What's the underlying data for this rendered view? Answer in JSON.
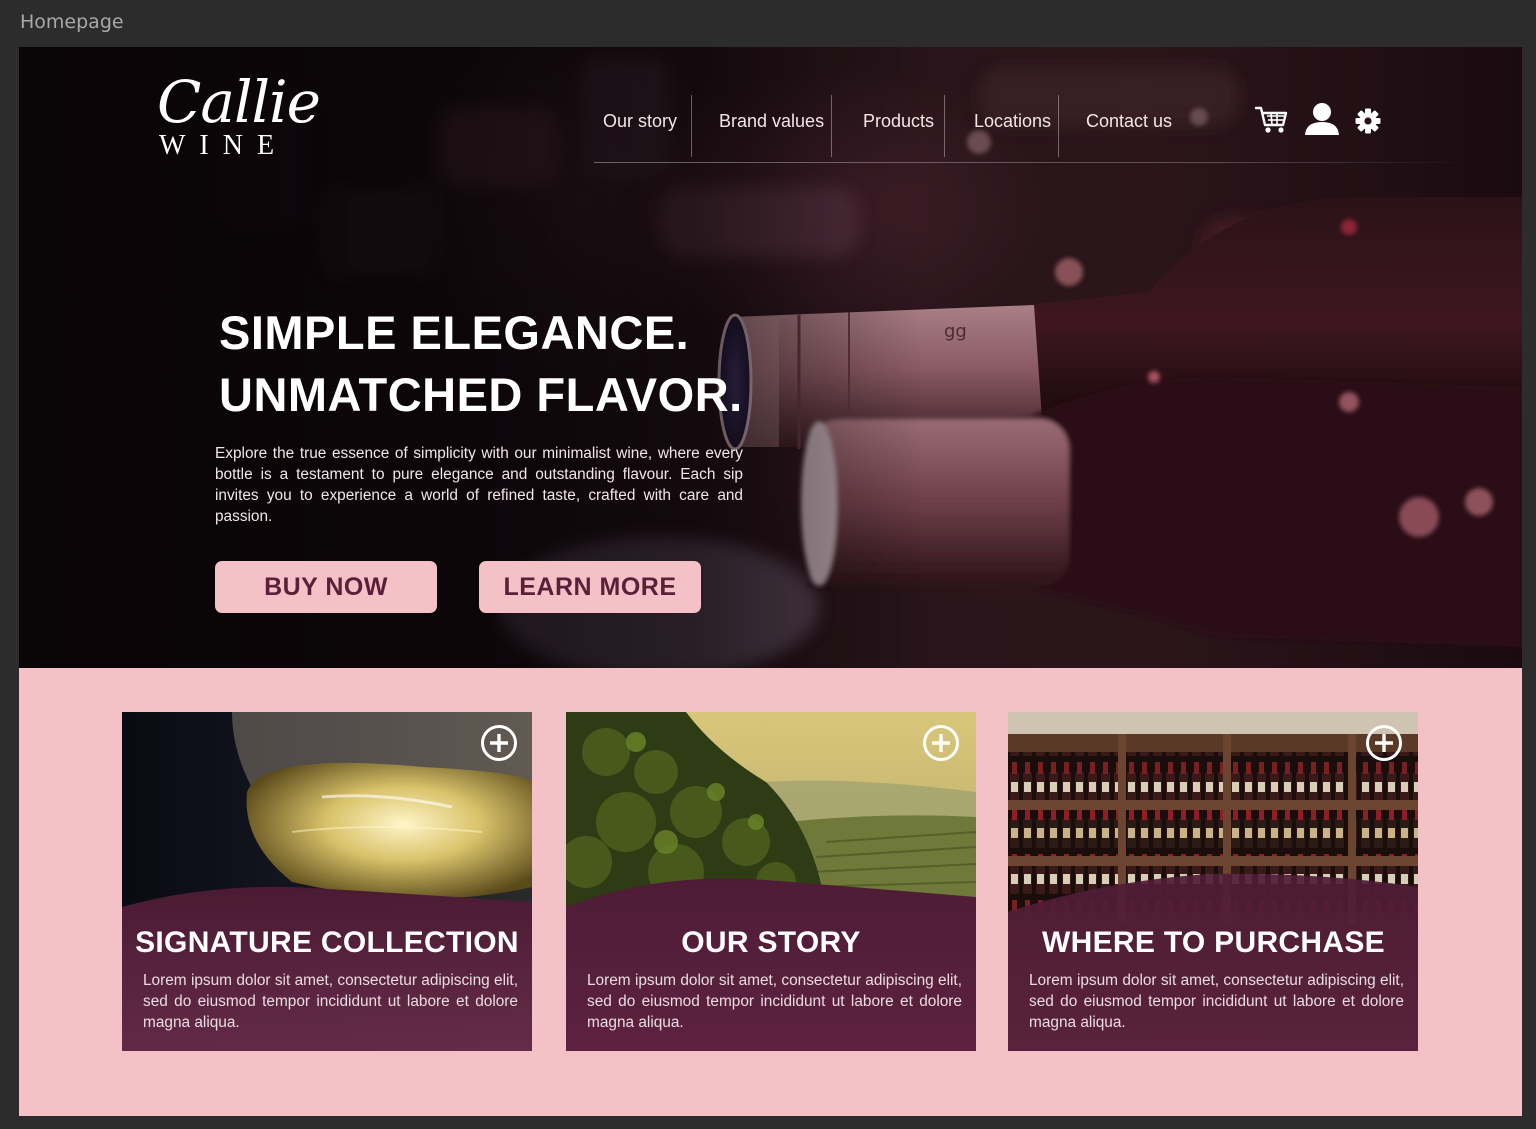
{
  "frame": {
    "label": "Homepage"
  },
  "brand": {
    "script": "Callie",
    "word": "WINE"
  },
  "nav": {
    "items": [
      "Our story",
      "Brand values",
      "Products",
      "Locations",
      "Contact us"
    ],
    "icons": [
      "cart-icon",
      "user-icon",
      "gear-icon"
    ]
  },
  "hero": {
    "title_line1": "SIMPLE ELEGANCE.",
    "title_line2": "UNMATCHED FLAVOR.",
    "body": "Explore the true essence of simplicity with our minimalist wine, where every bottle is a testament to pure elegance and outstanding flavour. Each sip invites you to experience a world of refined taste, crafted with care and passion.",
    "buy_label": "BUY NOW",
    "learn_label": "LEARN MORE"
  },
  "cards": [
    {
      "title": "SIGNATURE COLLECTION",
      "text": "Lorem ipsum dolor sit amet, consectetur adipiscing elit, sed do eiusmod tempor incididunt ut labore et dolore magna aliqua."
    },
    {
      "title": "OUR STORY",
      "text": "Lorem ipsum dolor sit amet, consectetur adipiscing elit, sed do eiusmod tempor incididunt ut labore et dolore magna aliqua."
    },
    {
      "title": "WHERE TO PURCHASE",
      "text": "Lorem ipsum dolor sit amet, consectetur adipiscing elit, sed do eiusmod tempor incididunt ut labore et dolore magna aliqua."
    }
  ],
  "colors": {
    "accent_pink": "#f4c1c6",
    "plum": "#5b1f3a",
    "card_overlay": "#4e1c36",
    "frame_bg": "#2c2c2c"
  }
}
